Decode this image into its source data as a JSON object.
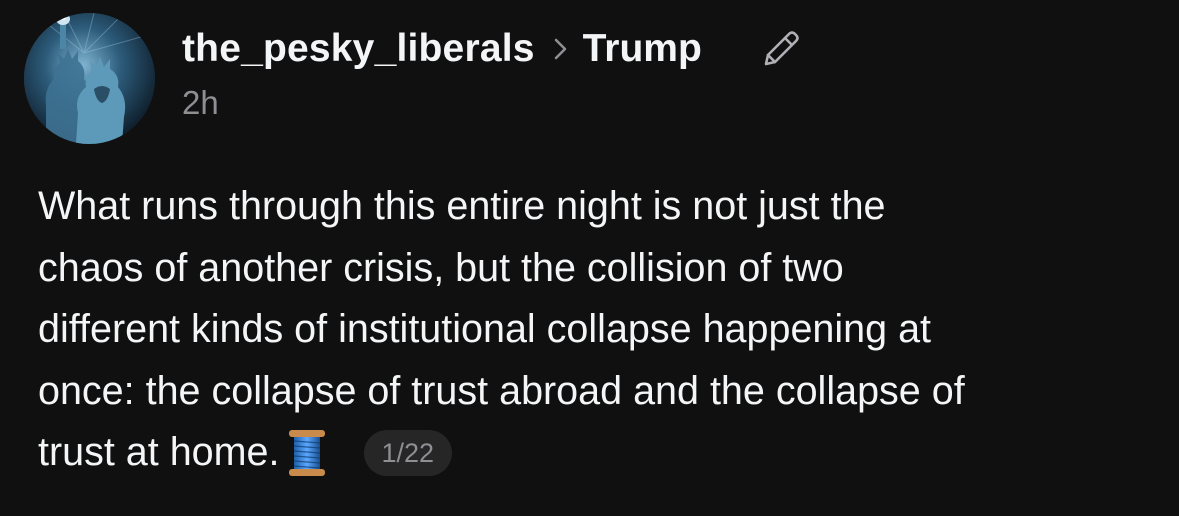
{
  "post": {
    "author": {
      "username": "the_pesky_liberals"
    },
    "community": "Trump",
    "timestamp": "2h",
    "text_lines": [
      "What runs through this entire night is not just the",
      "chaos of another crisis, but the collision of two",
      "different kinds of institutional collapse happening at",
      "once: the collapse of trust abroad and the collapse of",
      "trust at home."
    ],
    "thread_emoji": "spool-of-thread-icon",
    "thread_position": "1/22"
  },
  "colors": {
    "background": "#101010",
    "primary_text": "#f3f5f7",
    "secondary_text": "#8e8e93",
    "badge_background": "#262626"
  }
}
